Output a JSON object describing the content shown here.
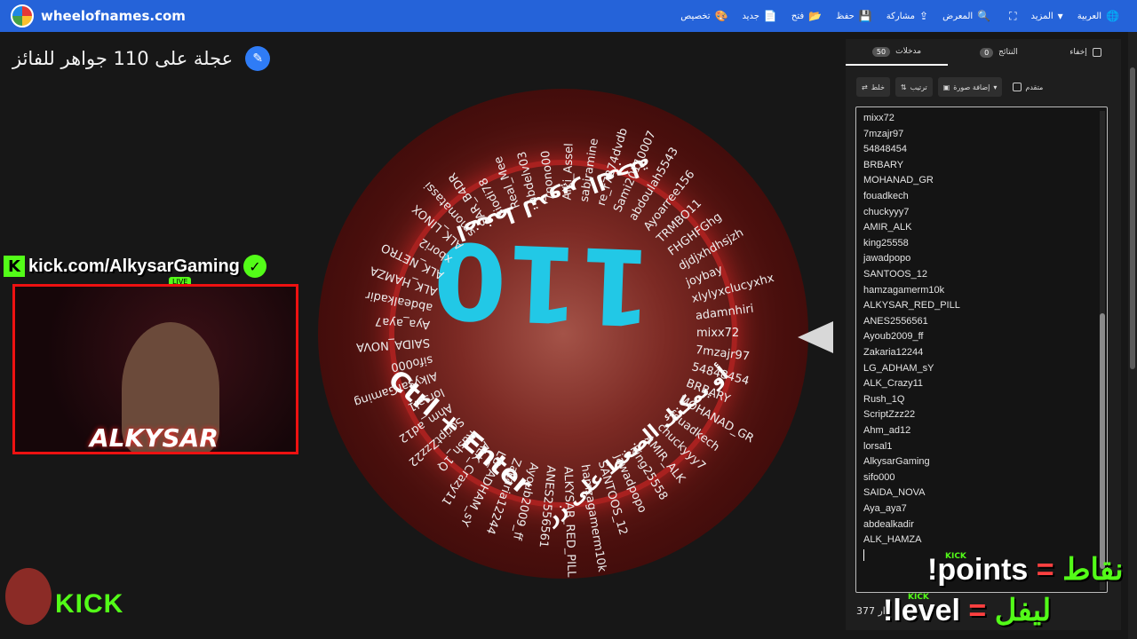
{
  "header": {
    "site": "wheelofnames.com",
    "menu": [
      {
        "label": "العربية",
        "icon": "globe-icon",
        "glyph": "🌐"
      },
      {
        "label": "المزيد",
        "icon": "chevron-down-icon",
        "glyph": "▾"
      },
      {
        "label": "",
        "icon": "fullscreen-icon",
        "glyph": "⛶"
      },
      {
        "label": "المعرض",
        "icon": "search-icon",
        "glyph": "🔍"
      },
      {
        "label": "مشاركة",
        "icon": "share-icon",
        "glyph": "⇪"
      },
      {
        "label": "حفظ",
        "icon": "save-icon",
        "glyph": "💾"
      },
      {
        "label": "فتح",
        "icon": "folder-icon",
        "glyph": "📂"
      },
      {
        "label": "جديد",
        "icon": "file-icon",
        "glyph": "📄"
      },
      {
        "label": "تخصيص",
        "icon": "palette-icon",
        "glyph": "🎨"
      }
    ]
  },
  "wheel": {
    "title": "عجلة على 110 جواهر للفائز",
    "big_number": "110",
    "text_spin": "اضغط لتدوير العجلة",
    "text_ctrl": "Ctrl + Enter",
    "text_or": "أو يمكنك الضغط على زر",
    "names": [
      "mixx72",
      "7mzajr97",
      "54848454",
      "BRBARY",
      "MOHANAD_GR",
      "fouadkech",
      "chuckyyy7",
      "AMIR_ALK",
      "king25558",
      "jawadpopo",
      "SANTOOS_12",
      "hamzagamerm10k",
      "ALKYSAR_RED_PILL",
      "ANES2556561",
      "Ayoub2009_ff",
      "Zakaria12244",
      "LG_ADHAM_sY",
      "ALK_Crazy11",
      "Rush_1Q",
      "ScriptZzz22",
      "Ahm_ad12",
      "lorsal1",
      "AlkysarGaming",
      "sifo000",
      "SAIDA_NOVA",
      "Aya_aya7",
      "abdealkadir",
      "ALK_HAMZA",
      "ALK_NETRO",
      "xbori2",
      "ALK_LINOX",
      "smomatassi",
      "SAR_B4DR",
      "siodi78",
      "Real_Mee",
      "abdelv03",
      "7nono00",
      "Alki_Assel",
      "sabiramine",
      "re_r7274dvdb",
      "Sami20110007",
      "abdoulah5543",
      "Ayoarree156",
      "TRMBO11",
      "FHGHFGhg",
      "djdjxhdhsjzh",
      "joybay",
      "xlylyxclucyxhx",
      "adamnhiri"
    ]
  },
  "overlay": {
    "kick_url": "kick.com/AlkysarGaming",
    "live": "LIVE",
    "signature": "ALKYSAR",
    "kick_logo": "KICK",
    "points_cmd": "!points",
    "points_ar": "نقاط",
    "level_cmd": "!level",
    "level_ar": "ليفل",
    "equals": "="
  },
  "panel": {
    "tab_entries": "مدخلات",
    "tab_entries_count": "50",
    "tab_results": "النتائج",
    "tab_results_count": "0",
    "hide_label": "إخفاء",
    "shuffle_label": "خلط",
    "sort_label": "ترتيب",
    "add_image_label": "إضافة صورة",
    "advanced_label": "متقدم",
    "entries": [
      "mixx72",
      "7mzajr97",
      "54848454",
      "BRBARY",
      "MOHANAD_GR",
      "fouadkech",
      "chuckyyy7",
      "AMIR_ALK",
      "king25558",
      "jawadpopo",
      "SANTOOS_12",
      "hamzagamerm10k",
      "ALKYSAR_RED_PILL",
      "ANES2556561",
      "Ayoub2009_ff",
      "Zakaria12244",
      "LG_ADHAM_sY",
      "ALK_Crazy11",
      "Rush_1Q",
      "ScriptZzz22",
      "Ahm_ad12",
      "lorsal1",
      "AlkysarGaming",
      "sifo000",
      "SAIDA_NOVA",
      "Aya_aya7",
      "abdealkadir",
      "ALK_HAMZA"
    ],
    "count_text": "377 ار"
  }
}
